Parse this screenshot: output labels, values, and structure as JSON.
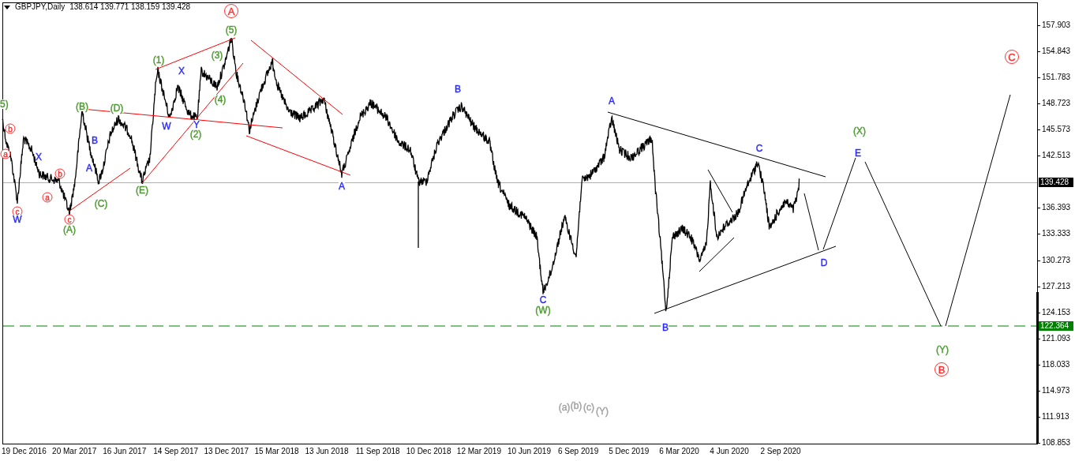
{
  "chart_header": {
    "symbol": "GBPJPY,Daily",
    "ohlc": "138.614 139.771 138.159 139.428"
  },
  "price_axis": {
    "ticks": [
      "157.903",
      "154.843",
      "151.783",
      "148.723",
      "145.573",
      "142.513",
      "136.393",
      "133.333",
      "130.273",
      "127.213",
      "124.153",
      "121.093",
      "118.033",
      "114.973",
      "111.913",
      "108.853"
    ],
    "current_price": "139.428",
    "level_price": "122.364"
  },
  "time_axis": [
    "19 Dec 2016",
    "20 Mar 2017",
    "16 Jun 2017",
    "14 Sep 2017",
    "13 Dec 2017",
    "15 Mar 2018",
    "13 Jun 2018",
    "11 Sep 2018",
    "10 Dec 2018",
    "12 Mar 2019",
    "10 Jun 2019",
    "6 Sep 2019",
    "5 Dec 2019",
    "6 Mar 2020",
    "4 Jun 2020",
    "2 Sep 2020"
  ],
  "wave_labels": [
    {
      "text": "5)",
      "color": "#4b9a2e",
      "kind": "plain"
    },
    {
      "text": "b",
      "color": "#ff3030",
      "kind": "circled"
    },
    {
      "text": "a",
      "color": "#ff3030",
      "kind": "circled"
    },
    {
      "text": "X",
      "color": "#2a2aff",
      "kind": "plain"
    },
    {
      "text": "c",
      "color": "#ff3030",
      "kind": "circled"
    },
    {
      "text": "W",
      "color": "#2a2aff",
      "kind": "plain"
    },
    {
      "text": "b",
      "color": "#ff3030",
      "kind": "circled"
    },
    {
      "text": "a",
      "color": "#ff3030",
      "kind": "circled"
    },
    {
      "text": "c",
      "color": "#ff3030",
      "kind": "circled"
    },
    {
      "text": "(A)",
      "color": "#4b9a2e",
      "kind": "plain"
    },
    {
      "text": "(B)",
      "color": "#4b9a2e",
      "kind": "plain"
    },
    {
      "text": "B",
      "color": "#2a2aff",
      "kind": "plain"
    },
    {
      "text": "A",
      "color": "#2a2aff",
      "kind": "plain"
    },
    {
      "text": "(C)",
      "color": "#4b9a2e",
      "kind": "plain"
    },
    {
      "text": "(D)",
      "color": "#4b9a2e",
      "kind": "plain"
    },
    {
      "text": "(E)",
      "color": "#4b9a2e",
      "kind": "plain"
    },
    {
      "text": "(1)",
      "color": "#4b9a2e",
      "kind": "plain"
    },
    {
      "text": "X",
      "color": "#2a2aff",
      "kind": "plain"
    },
    {
      "text": "W",
      "color": "#2a2aff",
      "kind": "plain"
    },
    {
      "text": "Y",
      "color": "#2a2aff",
      "kind": "plain"
    },
    {
      "text": "(2)",
      "color": "#4b9a2e",
      "kind": "plain"
    },
    {
      "text": "(3)",
      "color": "#4b9a2e",
      "kind": "plain"
    },
    {
      "text": "(4)",
      "color": "#4b9a2e",
      "kind": "plain"
    },
    {
      "text": "(5)",
      "color": "#4b9a2e",
      "kind": "plain"
    },
    {
      "text": "A",
      "color": "#ff3030",
      "kind": "circled_large"
    },
    {
      "text": "A",
      "color": "#2a2aff",
      "kind": "plain"
    },
    {
      "text": "B",
      "color": "#2a2aff",
      "kind": "plain"
    },
    {
      "text": "C",
      "color": "#2a2aff",
      "kind": "plain"
    },
    {
      "text": "(W)",
      "color": "#4b9a2e",
      "kind": "plain"
    },
    {
      "text": "A",
      "color": "#2a2aff",
      "kind": "plain"
    },
    {
      "text": "B",
      "color": "#2a2aff",
      "kind": "plain"
    },
    {
      "text": "C",
      "color": "#2a2aff",
      "kind": "plain"
    },
    {
      "text": "D",
      "color": "#2a2aff",
      "kind": "plain"
    },
    {
      "text": "(X)",
      "color": "#4b9a2e",
      "kind": "plain"
    },
    {
      "text": "E",
      "color": "#2a2aff",
      "kind": "plain"
    },
    {
      "text": "(Y)",
      "color": "#4b9a2e",
      "kind": "plain"
    },
    {
      "text": "B",
      "color": "#ff3030",
      "kind": "circled_large"
    },
    {
      "text": "C",
      "color": "#ff3030",
      "kind": "circled_large"
    },
    {
      "text": "(a)",
      "color": "#a0a0a0",
      "kind": "plain"
    },
    {
      "text": "(b)",
      "color": "#a0a0a0",
      "kind": "plain"
    },
    {
      "text": "(c)",
      "color": "#a0a0a0",
      "kind": "plain"
    },
    {
      "text": "(Y)",
      "color": "#a0a0a0",
      "kind": "plain"
    }
  ]
}
